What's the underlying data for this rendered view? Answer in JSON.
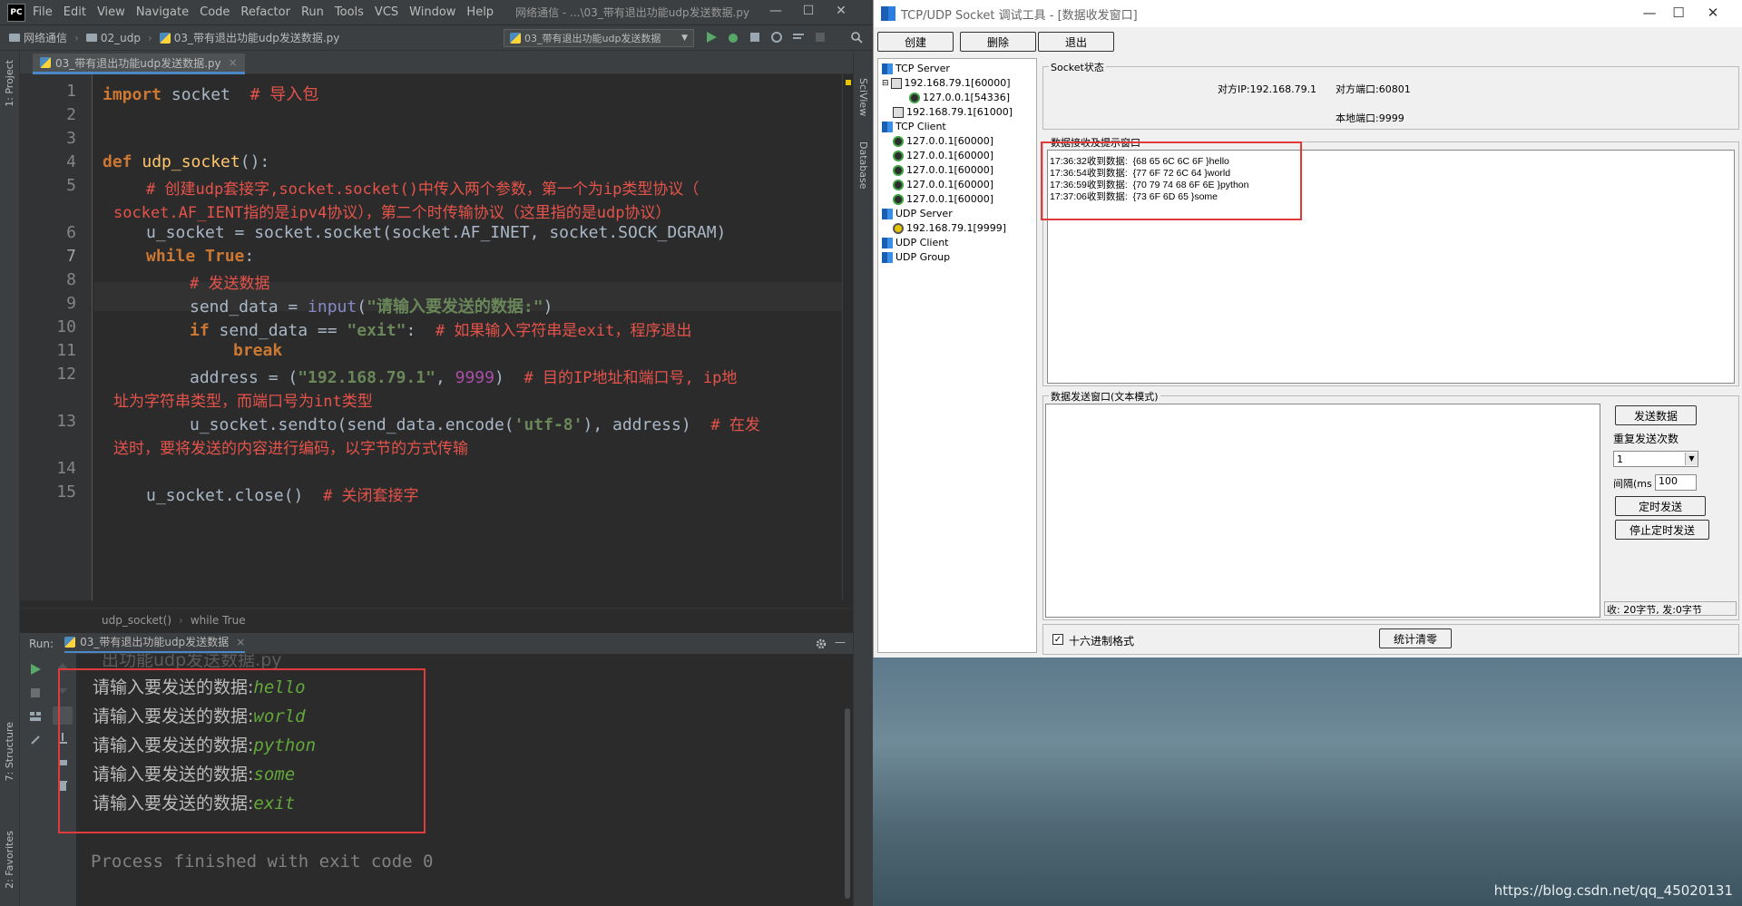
{
  "ide": {
    "menu": [
      "File",
      "Edit",
      "View",
      "Navigate",
      "Code",
      "Refactor",
      "Run",
      "Tools",
      "VCS",
      "Window",
      "Help"
    ],
    "window_title": "网络通信 - ...\\03_带有退出功能udp发送数据.py",
    "nav": {
      "project": "网络通信",
      "folder": "02_udp",
      "file": "03_带有退出功能udp发送数据.py"
    },
    "run_config": "03_带有退出功能udp发送数据",
    "left_labels": {
      "project": "1: Project",
      "structure": "7: Structure",
      "favorites": "2: Favorites"
    },
    "right_labels": {
      "sciview": "SciView",
      "database": "Database"
    },
    "tab": "03_带有退出功能udp发送数据.py",
    "lines": [
      "1",
      "2",
      "3",
      "4",
      "5",
      "",
      "6",
      "7",
      "8",
      "9",
      "10",
      "11",
      "12",
      "",
      "13",
      "",
      "14",
      "15"
    ],
    "code": {
      "l1_kw": "import",
      "l1_mod": " socket  ",
      "l1_cm": "# 导入包",
      "l4_kw": "def",
      "l4_fn": "udp_socket",
      "l4_rest": "():",
      "l5_cm": "# 创建udp套接字,socket.socket()中传入两个参数，第一个为ip类型协议（",
      "l5b_cm": "socket.AF_IENT指的是ipv4协议），第二个时传输协议（这里指的是udp协议）",
      "l6": "u_socket = socket.socket(socket.AF_INET, socket.SOCK_DGRAM)",
      "l7_kw": "while True",
      "l7_rest": ":",
      "l8_cm": "# 发送数据",
      "l9_a": "send_data = ",
      "l9_bi": "input",
      "l9_p": "(",
      "l9_st": "\"请输入要发送的数据:\"",
      "l9_e": ")",
      "l10_kw": "if",
      "l10_a": " send_data == ",
      "l10_st": "\"exit\"",
      "l10_b": ":  ",
      "l10_cm": "# 如果输入字符串是exit，程序退出",
      "l11_kw": "break",
      "l12_a": "address = (",
      "l12_st": "\"192.168.79.1\"",
      "l12_b": ", ",
      "l12_num": "9999",
      "l12_c": ")  ",
      "l12_cm": "# 目的IP地址和端口号, ip地",
      "l12b_cm": "址为字符串类型，而端口号为int类型",
      "l13_a": "u_socket.sendto(send_data.encode(",
      "l13_st": "'utf-8'",
      "l13_b": "), address)  ",
      "l13_cm": "# 在发",
      "l13b_cm": "送时，要将发送的内容进行编码，以字节的方式传输",
      "l15_a": "u_socket.close()  ",
      "l15_cm": "# 关闭套接字"
    },
    "breadcrumb": [
      "udp_socket()",
      "while True"
    ],
    "run": {
      "label": "Run:",
      "tab": "03_带有退出功能udp发送数据",
      "scrolled_ghost": "出功能udp发送数据.py",
      "prompt": "请输入要发送的数据:",
      "inputs": [
        "hello",
        "world",
        "python",
        "some",
        "exit"
      ],
      "finished": "Process finished with exit code 0"
    }
  },
  "tool": {
    "title": "TCP/UDP Socket 调试工具 - [数据收发窗口]",
    "buttons": {
      "create": "创建",
      "delete": "删除",
      "exit": "退出"
    },
    "tree": {
      "tcp_server": "TCP Server",
      "ts1": "192.168.79.1[60000]",
      "ts1_child": "127.0.0.1[54336]",
      "ts2": "192.168.79.1[61000]",
      "tcp_client": "TCP Client",
      "tc": [
        "127.0.0.1[60000]",
        "127.0.0.1[60000]",
        "127.0.0.1[60000]",
        "127.0.0.1[60000]",
        "127.0.0.1[60000]"
      ],
      "udp_server": "UDP Server",
      "us1": "192.168.79.1[9999]",
      "udp_client": "UDP Client",
      "udp_group": "UDP Group"
    },
    "status": {
      "group": "Socket状态",
      "peer_ip": "对方IP:192.168.79.1",
      "peer_port": "对方端口:60801",
      "local_port": "本地端口:9999"
    },
    "recv": {
      "group": "数据接收及提示窗口",
      "lines": [
        "17:36:32收到数据:  {68 65 6C 6C 6F }hello",
        "17:36:54收到数据:  {77 6F 72 6C 64 }world",
        "17:36:59收到数据:  {70 79 74 68 6F 6E }python",
        "17:37:06收到数据:  {73 6F 6D 65 }some"
      ]
    },
    "send": {
      "group": "数据发送窗口(文本模式)",
      "send_btn": "发送数据",
      "repeat_label": "重复发送次数",
      "repeat_value": "1",
      "interval_label": "间隔(ms",
      "interval_value": "100",
      "timed_btn": "定时发送",
      "stop_btn": "停止定时发送",
      "stats": "收: 20字节, 发:0字节",
      "hex_label": "十六进制格式",
      "clear_btn": "统计清零"
    }
  },
  "watermark": "https://blog.csdn.net/qq_45020131",
  "colors": {
    "accent_red": "#e03a3a",
    "ide_bg": "#2b2b2b",
    "console_input": "#62a83a"
  }
}
